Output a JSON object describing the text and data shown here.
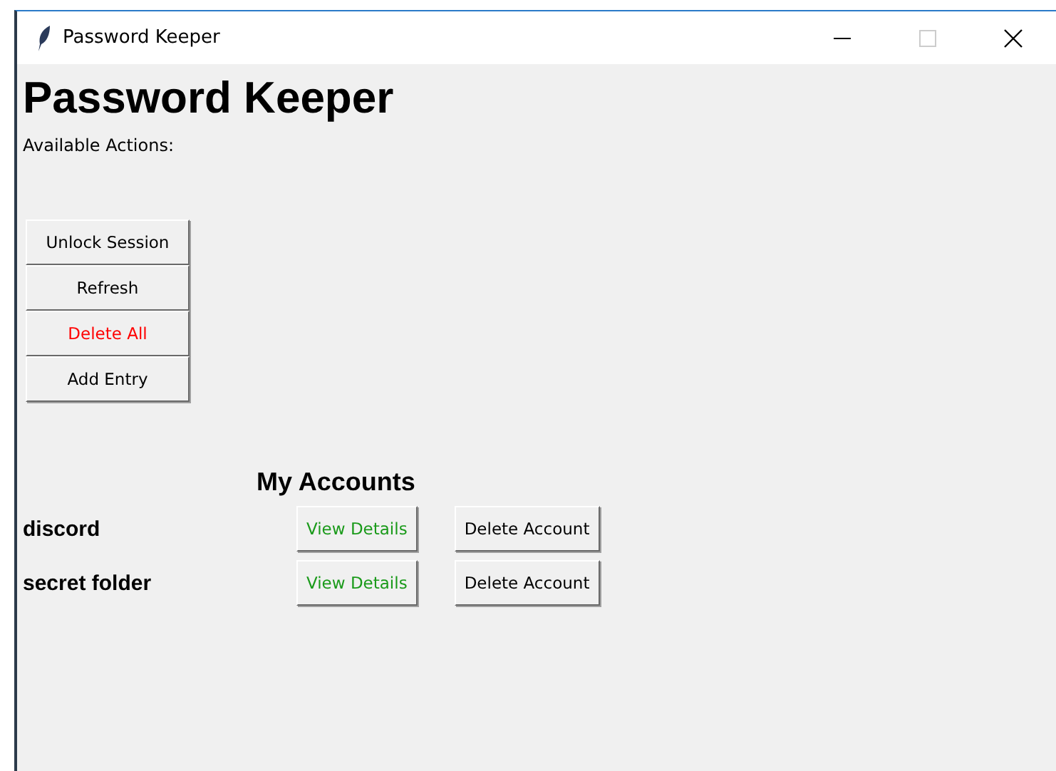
{
  "window": {
    "title": "Password Keeper"
  },
  "heading": "Password Keeper",
  "actions_label": "Available Actions:",
  "actions": [
    {
      "label": "Unlock Session",
      "kind": "normal"
    },
    {
      "label": "Refresh",
      "kind": "normal"
    },
    {
      "label": "Delete All",
      "kind": "danger"
    },
    {
      "label": "Add Entry",
      "kind": "normal"
    }
  ],
  "accounts_title": "My Accounts",
  "accounts": [
    {
      "name": "discord",
      "buttons": [
        {
          "label": "View Details",
          "kind": "view"
        },
        {
          "label": "Delete Account",
          "kind": "normal"
        }
      ]
    },
    {
      "name": "secret folder",
      "buttons": [
        {
          "label": "View Details",
          "kind": "view"
        },
        {
          "label": "Delete Account",
          "kind": "normal"
        }
      ]
    }
  ]
}
